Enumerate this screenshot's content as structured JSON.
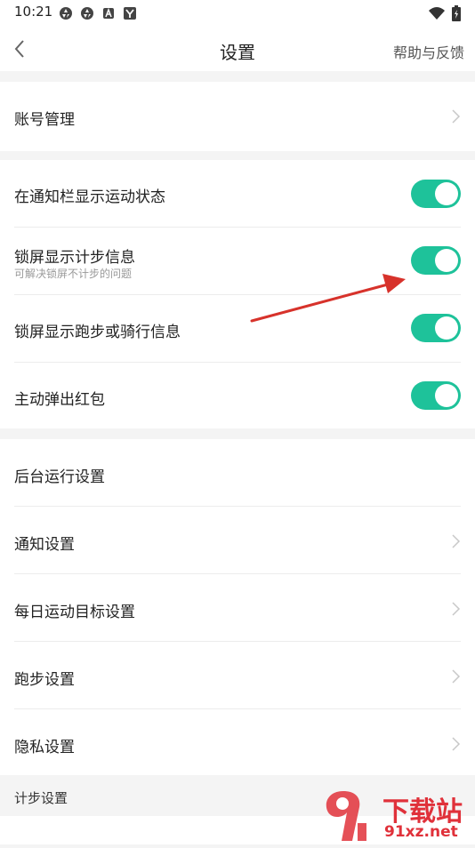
{
  "status_bar": {
    "time": "10:21"
  },
  "header": {
    "title": "设置",
    "help": "帮助与反馈"
  },
  "account": {
    "label": "账号管理"
  },
  "toggles": [
    {
      "label": "在通知栏显示运动状态",
      "on": true
    },
    {
      "label": "锁屏显示计步信息",
      "sub": "可解决锁屏不计步的问题",
      "on": true
    },
    {
      "label": "锁屏显示跑步或骑行信息",
      "on": true
    },
    {
      "label": "主动弹出红包",
      "on": true
    }
  ],
  "settings": [
    {
      "label": "后台运行设置"
    },
    {
      "label": "通知设置"
    },
    {
      "label": "每日运动目标设置"
    },
    {
      "label": "跑步设置"
    },
    {
      "label": "隐私设置"
    }
  ],
  "step_section": {
    "title": "计步设置"
  },
  "watermark": {
    "text": "下载站",
    "domain": "91xz.net"
  },
  "colors": {
    "accent": "#1ec29a",
    "arrow": "#d7322b"
  }
}
